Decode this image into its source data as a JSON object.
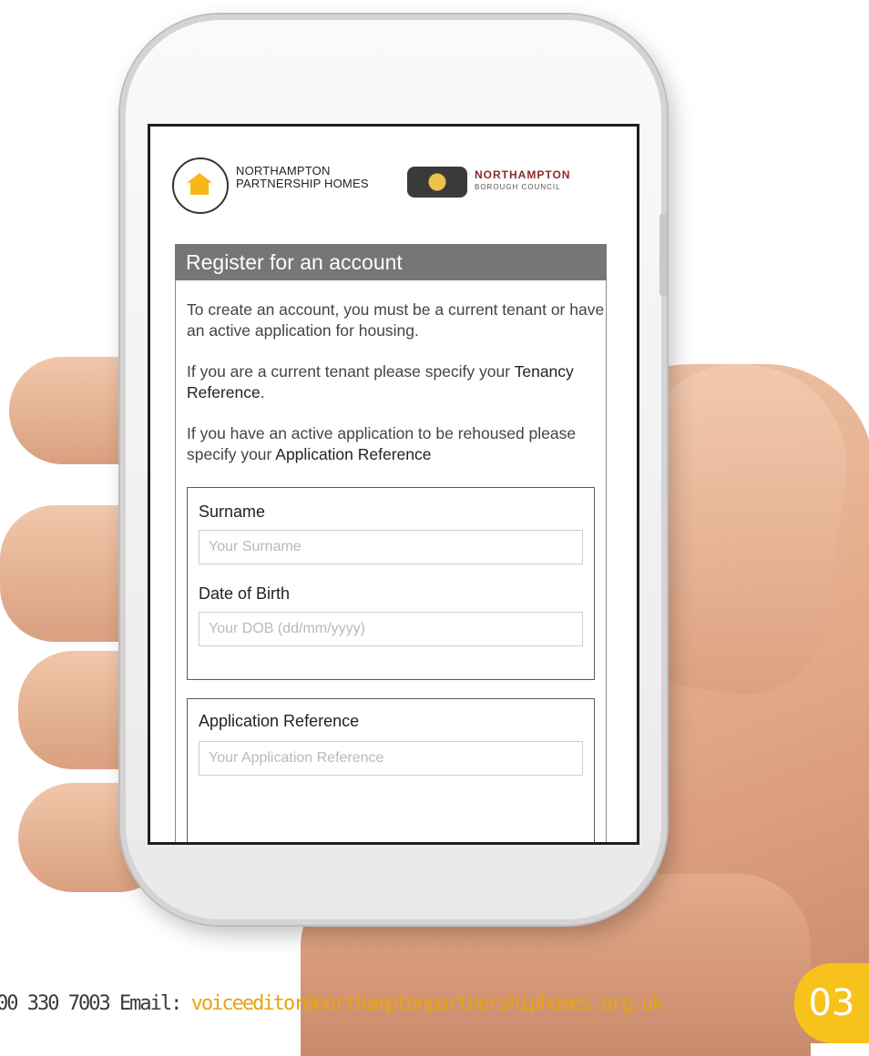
{
  "header": {
    "nph_line1": "NORTHAMPTON",
    "nph_line2": "PARTNERSHIP HOMES",
    "nbc_title": "NORTHAMPTON",
    "nbc_subtitle": "BOROUGH COUNCIL"
  },
  "form": {
    "title": "Register for an account",
    "intro": "To create an account, you must be a current tenant or have an active application for housing.",
    "tenant_text": "If you are a current tenant please specify your",
    "tenant_ref_label": "Tenancy Reference",
    "tenant_suffix": ".",
    "applicant_text": "If you have an active application to be rehoused please specify your",
    "applicant_ref_label": "Application Reference",
    "surname_label": "Surname",
    "surname_placeholder": "Your Surname",
    "dob_label": "Date of Birth",
    "dob_placeholder": "Your DOB (dd/mm/yyyy)",
    "appref_label": "Application Reference",
    "appref_placeholder": "Your Application Reference"
  },
  "footer": {
    "phone_text": "00 330 7003 Email:",
    "email": "voiceeditor@northamptonpartnershiphomes.org.uk",
    "page_number": "03"
  },
  "colors": {
    "badge": "#f7c21b",
    "panel_header": "#767676",
    "email_link": "#e6a50f"
  }
}
